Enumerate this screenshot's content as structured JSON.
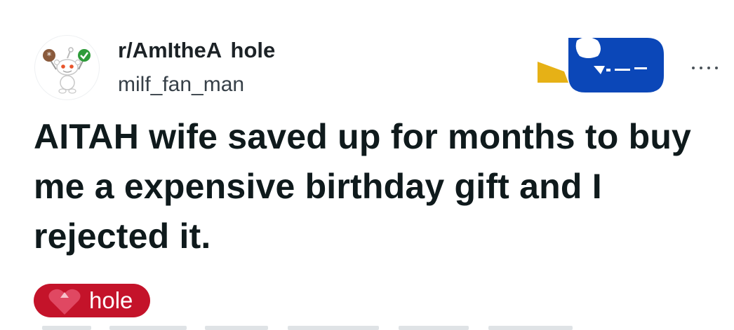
{
  "post": {
    "subreddit": "r/AmItheA  hole",
    "username": "milf_fan_man",
    "title": "AITAH wife saved up for months to buy me a expensive birthday gift and I rejected it.",
    "flair": {
      "label": "hole",
      "background": "#c4132a"
    }
  },
  "icons": {
    "avatar": "snoo-avatar-icon",
    "award": "award-icon",
    "more": "more-options-icon",
    "flair": "heart-icon"
  },
  "colors": {
    "title_text": "#0f1a1c",
    "award_blue": "#0b47b8",
    "award_gold": "#e6b116"
  }
}
